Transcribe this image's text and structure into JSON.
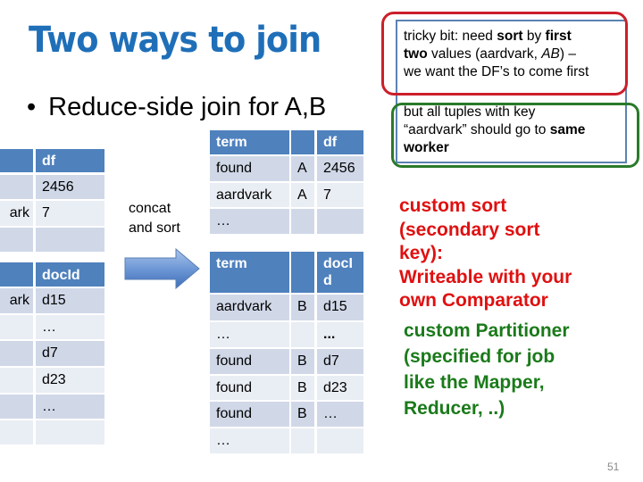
{
  "slide": {
    "title": "Two ways to join",
    "bullet": "Reduce-side join for A,B",
    "page_number": "51"
  },
  "left_top_table": {
    "headers": [
      "",
      "df"
    ],
    "rows": [
      [
        "",
        "2456"
      ],
      [
        "ark",
        "7"
      ],
      [
        "",
        ""
      ]
    ]
  },
  "left_bottom_table": {
    "headers": [
      "",
      "docId"
    ],
    "rows": [
      [
        "ark",
        "d15"
      ],
      [
        "",
        "…"
      ],
      [
        "",
        "d7"
      ],
      [
        "",
        "d23"
      ],
      [
        "",
        "…"
      ],
      [
        "",
        ""
      ]
    ]
  },
  "concat_label": {
    "line1": "concat",
    "line2": "and sort"
  },
  "arrow": {
    "icon": "right-arrow-icon",
    "color": "#4f81bd"
  },
  "mid_top_table": {
    "headers": [
      "term",
      "",
      "df"
    ],
    "rows": [
      [
        "found",
        "A",
        "2456"
      ],
      [
        "aardvark",
        "A",
        "7"
      ],
      [
        "…",
        "",
        ""
      ]
    ]
  },
  "mid_bottom_table": {
    "headers": [
      "term",
      "",
      "docI",
      "d"
    ],
    "rows": [
      [
        "aardvark",
        "B",
        "d15"
      ],
      [
        "…",
        "",
        "..."
      ],
      [
        "found",
        "B",
        "d7"
      ],
      [
        "found",
        "B",
        "d23"
      ],
      [
        "found",
        "B",
        "…"
      ],
      [
        "…",
        "",
        ""
      ]
    ]
  },
  "callouts": {
    "red": {
      "t1": "tricky bit: need ",
      "b1": "sort",
      "t2": " by ",
      "b2": "first",
      "b3": "two",
      "t3": " values (aardvark, ",
      "i1": "AB",
      "t4": ") –",
      "t5": "we want the DF’s to come first",
      "color": "#cc1f2a"
    },
    "green": {
      "t1": "but all tuples with key",
      "t2": "“aardvark” should go to ",
      "b1": "same",
      "b2": "worker",
      "color": "#2a7a2a"
    }
  },
  "notes": {
    "custom_sort": [
      "custom sort",
      "(secondary sort",
      "key):",
      "Writeable with your",
      "own Comparator"
    ],
    "custom_partitioner": [
      "custom Partitioner",
      "(specified for job",
      "like the Mapper,",
      "Reducer, ..)"
    ]
  },
  "colors": {
    "title": "#1f6fb8",
    "table_header": "#4f81bd",
    "row_odd": "#d0d8e8",
    "row_even": "#e9edf4",
    "note_red": "#e01010",
    "note_green": "#1a7a1a"
  }
}
